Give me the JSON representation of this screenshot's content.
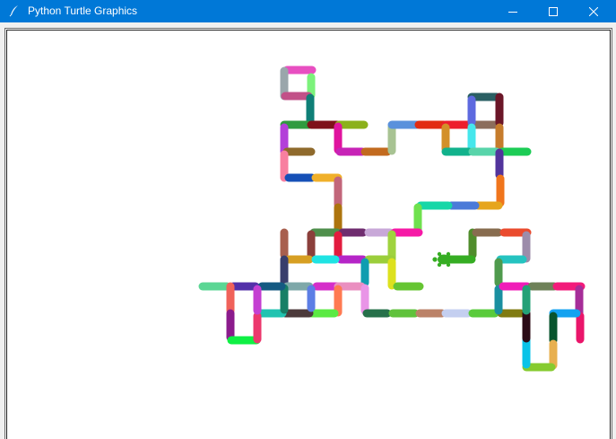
{
  "window": {
    "title": "Python Turtle Graphics",
    "icon": "feather-pen-icon",
    "titlebar_color": "#0078d7",
    "controls": [
      "minimize-icon",
      "maximize-icon",
      "close-icon"
    ]
  },
  "canvas": {
    "background": "#ffffff",
    "line_segments": [
      [
        "#e84fc1",
        [
          320,
          78
        ],
        [
          348,
          78
        ]
      ],
      [
        "#9aa6ab",
        [
          317,
          79
        ],
        [
          317,
          107
        ]
      ],
      [
        "#7cf27b",
        [
          347,
          86
        ],
        [
          347,
          106
        ]
      ],
      [
        "#c25188",
        [
          318,
          107
        ],
        [
          344,
          107
        ]
      ],
      [
        "#0f7f77",
        [
          346,
          109
        ],
        [
          346,
          136
        ]
      ],
      [
        "#2f9b3f",
        [
          317,
          139
        ],
        [
          345,
          139
        ]
      ],
      [
        "#7f111a",
        [
          347,
          139
        ],
        [
          376,
          139
        ]
      ],
      [
        "#b33fd9",
        [
          317,
          142
        ],
        [
          317,
          169
        ]
      ],
      [
        "#8f6a2c",
        [
          320,
          169
        ],
        [
          347,
          169
        ]
      ],
      [
        "#8bb11b",
        [
          378,
          139
        ],
        [
          406,
          139
        ]
      ],
      [
        "#e0139e",
        [
          377,
          141
        ],
        [
          377,
          167
        ]
      ],
      [
        "#c723b6",
        [
          379,
          169
        ],
        [
          404,
          169
        ]
      ],
      [
        "#c26a1e",
        [
          407,
          169
        ],
        [
          432,
          169
        ]
      ],
      [
        "#a8c393",
        [
          437,
          141
        ],
        [
          437,
          168
        ]
      ],
      [
        "#5a91dc",
        [
          437,
          139
        ],
        [
          465,
          139
        ]
      ],
      [
        "#e22c12",
        [
          467,
          139
        ],
        [
          495,
          139
        ]
      ],
      [
        "#ed1d2d",
        [
          497,
          139
        ],
        [
          524,
          139
        ]
      ],
      [
        "#8c6d5c",
        [
          526,
          139
        ],
        [
          554,
          139
        ]
      ],
      [
        "#2a5f63",
        [
          526,
          108
        ],
        [
          554,
          108
        ]
      ],
      [
        "#5d69df",
        [
          526,
          111
        ],
        [
          526,
          136
        ]
      ],
      [
        "#6b1628",
        [
          557,
          108
        ],
        [
          557,
          137
        ]
      ],
      [
        "#d39029",
        [
          497,
          142
        ],
        [
          497,
          166
        ]
      ],
      [
        "#45e7ec",
        [
          526,
          142
        ],
        [
          526,
          167
        ]
      ],
      [
        "#c67c2c",
        [
          557,
          142
        ],
        [
          557,
          166
        ]
      ],
      [
        "#12b28c",
        [
          497,
          169
        ],
        [
          523,
          169
        ]
      ],
      [
        "#58d4aa",
        [
          527,
          169
        ],
        [
          554,
          169
        ]
      ],
      [
        "#1ccc55",
        [
          560,
          169
        ],
        [
          588,
          169
        ]
      ],
      [
        "#52349c",
        [
          557,
          170
        ],
        [
          557,
          195
        ]
      ],
      [
        "#f0751c",
        [
          558,
          199
        ],
        [
          558,
          226
        ]
      ],
      [
        "#e6a51d",
        [
          533,
          229
        ],
        [
          556,
          229
        ]
      ],
      [
        "#4b7ad8",
        [
          503,
          229
        ],
        [
          530,
          229
        ]
      ],
      [
        "#16d7a7",
        [
          469,
          229
        ],
        [
          500,
          229
        ]
      ],
      [
        "#6fe14e",
        [
          466,
          231
        ],
        [
          466,
          256
        ]
      ],
      [
        "#f87fa0",
        [
          317,
          172
        ],
        [
          317,
          198
        ]
      ],
      [
        "#1650b7",
        [
          322,
          198
        ],
        [
          348,
          198
        ]
      ],
      [
        "#f0b02a",
        [
          352,
          198
        ],
        [
          377,
          198
        ]
      ],
      [
        "#c2667a",
        [
          377,
          201
        ],
        [
          377,
          228
        ]
      ],
      [
        "#ad740e",
        [
          377,
          231
        ],
        [
          377,
          256
        ]
      ],
      [
        "#4f8f4c",
        [
          350,
          259
        ],
        [
          376,
          259
        ]
      ],
      [
        "#6f2d6f",
        [
          382,
          259
        ],
        [
          405,
          259
        ]
      ],
      [
        "#c8a8d8",
        [
          411,
          259
        ],
        [
          435,
          259
        ]
      ],
      [
        "#f61aa6",
        [
          440,
          259
        ],
        [
          467,
          259
        ]
      ],
      [
        "#9fd33e",
        [
          437,
          261
        ],
        [
          437,
          287
        ]
      ],
      [
        "#a85f4e",
        [
          317,
          259
        ],
        [
          317,
          284
        ]
      ],
      [
        "#8b3f3b",
        [
          347,
          261
        ],
        [
          347,
          284
        ]
      ],
      [
        "#e21b3e",
        [
          377,
          262
        ],
        [
          377,
          288
        ]
      ],
      [
        "#b525c7",
        [
          380,
          289
        ],
        [
          405,
          289
        ]
      ],
      [
        "#9bce3b",
        [
          411,
          289
        ],
        [
          437,
          289
        ]
      ],
      [
        "#dde11e",
        [
          437,
          292
        ],
        [
          437,
          318
        ]
      ],
      [
        "#66c532",
        [
          443,
          319
        ],
        [
          468,
          319
        ]
      ],
      [
        "#d79f23",
        [
          322,
          289
        ],
        [
          345,
          289
        ]
      ],
      [
        "#1fe3e3",
        [
          352,
          289
        ],
        [
          374,
          289
        ]
      ],
      [
        "#0f9db0",
        [
          407,
          292
        ],
        [
          407,
          315
        ]
      ],
      [
        "#393e6c",
        [
          317,
          289
        ],
        [
          317,
          315
        ]
      ],
      [
        "#7ea8a9",
        [
          320,
          319
        ],
        [
          345,
          319
        ]
      ],
      [
        "#d52ec9",
        [
          353,
          319
        ],
        [
          376,
          319
        ]
      ],
      [
        "#ea8fc0",
        [
          377,
          319
        ],
        [
          403,
          319
        ]
      ],
      [
        "#e995e7",
        [
          407,
          321
        ],
        [
          407,
          346
        ]
      ],
      [
        "#26704a",
        [
          409,
          349
        ],
        [
          432,
          349
        ]
      ],
      [
        "#60c23c",
        [
          438,
          349
        ],
        [
          463,
          349
        ]
      ],
      [
        "#bb8268",
        [
          468,
          349
        ],
        [
          493,
          349
        ]
      ],
      [
        "#c4cff0",
        [
          497,
          349
        ],
        [
          522,
          349
        ]
      ],
      [
        "#5acb3c",
        [
          527,
          349
        ],
        [
          552,
          349
        ]
      ],
      [
        "#807b12",
        [
          559,
          349
        ],
        [
          581,
          349
        ]
      ],
      [
        "#ff7a52",
        [
          377,
          322
        ],
        [
          377,
          348
        ]
      ],
      [
        "#5bea43",
        [
          347,
          349
        ],
        [
          373,
          349
        ]
      ],
      [
        "#4c3a3b",
        [
          318,
          349
        ],
        [
          345,
          349
        ]
      ],
      [
        "#21c3b0",
        [
          288,
          349
        ],
        [
          315,
          349
        ]
      ],
      [
        "#5c7ee5",
        [
          347,
          322
        ],
        [
          347,
          343
        ]
      ],
      [
        "#177f66",
        [
          317,
          321
        ],
        [
          317,
          345
        ]
      ],
      [
        "#5bd694",
        [
          226,
          319
        ],
        [
          253,
          319
        ]
      ],
      [
        "#5330a9",
        [
          260,
          319
        ],
        [
          285,
          319
        ]
      ],
      [
        "#145a82",
        [
          292,
          319
        ],
        [
          314,
          319
        ]
      ],
      [
        "#f0625a",
        [
          257,
          319
        ],
        [
          257,
          346
        ]
      ],
      [
        "#8b1b8c",
        [
          257,
          349
        ],
        [
          257,
          376
        ]
      ],
      [
        "#0ff044",
        [
          258,
          379
        ],
        [
          286,
          379
        ]
      ],
      [
        "#ec386d",
        [
          287,
          352
        ],
        [
          287,
          378
        ]
      ],
      [
        "#c43fd2",
        [
          287,
          322
        ],
        [
          287,
          346
        ]
      ],
      [
        "#508d2c",
        [
          527,
          259
        ],
        [
          527,
          284
        ]
      ],
      [
        "#876c4f",
        [
          531,
          259
        ],
        [
          556,
          259
        ]
      ],
      [
        "#ea4b2e",
        [
          562,
          259
        ],
        [
          588,
          259
        ]
      ],
      [
        "#9c8caa",
        [
          587,
          262
        ],
        [
          587,
          288
        ]
      ],
      [
        "#25c3c0",
        [
          558,
          289
        ],
        [
          583,
          289
        ]
      ],
      [
        "#4f9a4d",
        [
          556,
          292
        ],
        [
          556,
          315
        ]
      ],
      [
        "#1a8fa0",
        [
          556,
          322
        ],
        [
          556,
          346
        ]
      ],
      [
        "#f01db8",
        [
          561,
          319
        ],
        [
          588,
          319
        ]
      ],
      [
        "#6e8158",
        [
          593,
          319
        ],
        [
          618,
          319
        ]
      ],
      [
        "#f21b7a",
        [
          621,
          319
        ],
        [
          648,
          319
        ]
      ],
      [
        "#a62d98",
        [
          646,
          322
        ],
        [
          646,
          349
        ]
      ],
      [
        "#ea156a",
        [
          647,
          352
        ],
        [
          647,
          378
        ]
      ],
      [
        "#13a2f0",
        [
          617,
          349
        ],
        [
          643,
          349
        ]
      ],
      [
        "#08542d",
        [
          617,
          352
        ],
        [
          617,
          379
        ]
      ],
      [
        "#e8b04f",
        [
          617,
          383
        ],
        [
          617,
          407
        ]
      ],
      [
        "#86cb2f",
        [
          587,
          409
        ],
        [
          615,
          409
        ]
      ],
      [
        "#09c3e8",
        [
          587,
          379
        ],
        [
          587,
          406
        ]
      ],
      [
        "#2b0b16",
        [
          587,
          349
        ],
        [
          587,
          377
        ]
      ],
      [
        "#24a177",
        [
          587,
          322
        ],
        [
          587,
          346
        ]
      ],
      [
        "#36ad23",
        [
          497,
          289
        ],
        [
          526,
          289
        ]
      ]
    ],
    "turtle": {
      "shape": "turtle-icon",
      "color": "#36ad23",
      "heading": "west"
    }
  }
}
